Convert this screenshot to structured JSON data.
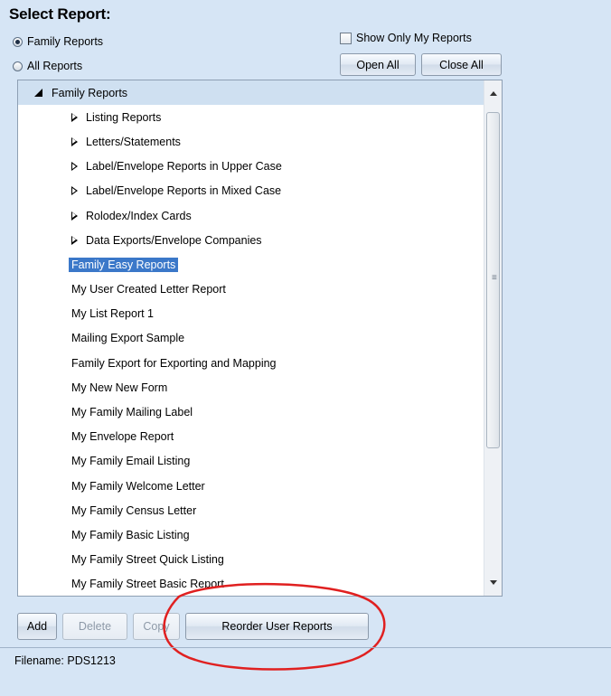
{
  "header": {
    "title": "Select Report:"
  },
  "filters": {
    "radios": [
      {
        "label": "Family Reports",
        "checked": true
      },
      {
        "label": "All Reports",
        "checked": false
      }
    ],
    "show_only_mine": {
      "label": "Show Only My Reports",
      "checked": false
    },
    "open_all": "Open All",
    "close_all": "Close All"
  },
  "tree": {
    "root": "Family Reports",
    "groups": [
      "Listing Reports",
      "Letters/Statements",
      "Label/Envelope Reports in Upper Case",
      "Label/Envelope Reports in Mixed Case",
      "Rolodex/Index Cards",
      "Data Exports/Envelope Companies"
    ],
    "open_group": "Family Easy Reports",
    "reports": [
      "My User Created Letter Report",
      "My List Report 1",
      "Mailing Export Sample",
      "Family Export for Exporting and Mapping",
      "My New New Form",
      "My Family Mailing Label",
      "My Envelope Report",
      "My Family Email Listing",
      "My Family Welcome Letter",
      "My Family Census Letter",
      "My Family Basic Listing",
      "My Family Street Quick Listing",
      "My Family Street Basic Report"
    ]
  },
  "actions": {
    "add": "Add",
    "delete": "Delete",
    "copy": "Copy",
    "reorder": "Reorder User Reports"
  },
  "footer": {
    "filename": "Filename: PDS1213"
  },
  "colors": {
    "selection": "#3b78c9",
    "highlight_annotation": "#e02020",
    "background": "#d6e5f5"
  }
}
